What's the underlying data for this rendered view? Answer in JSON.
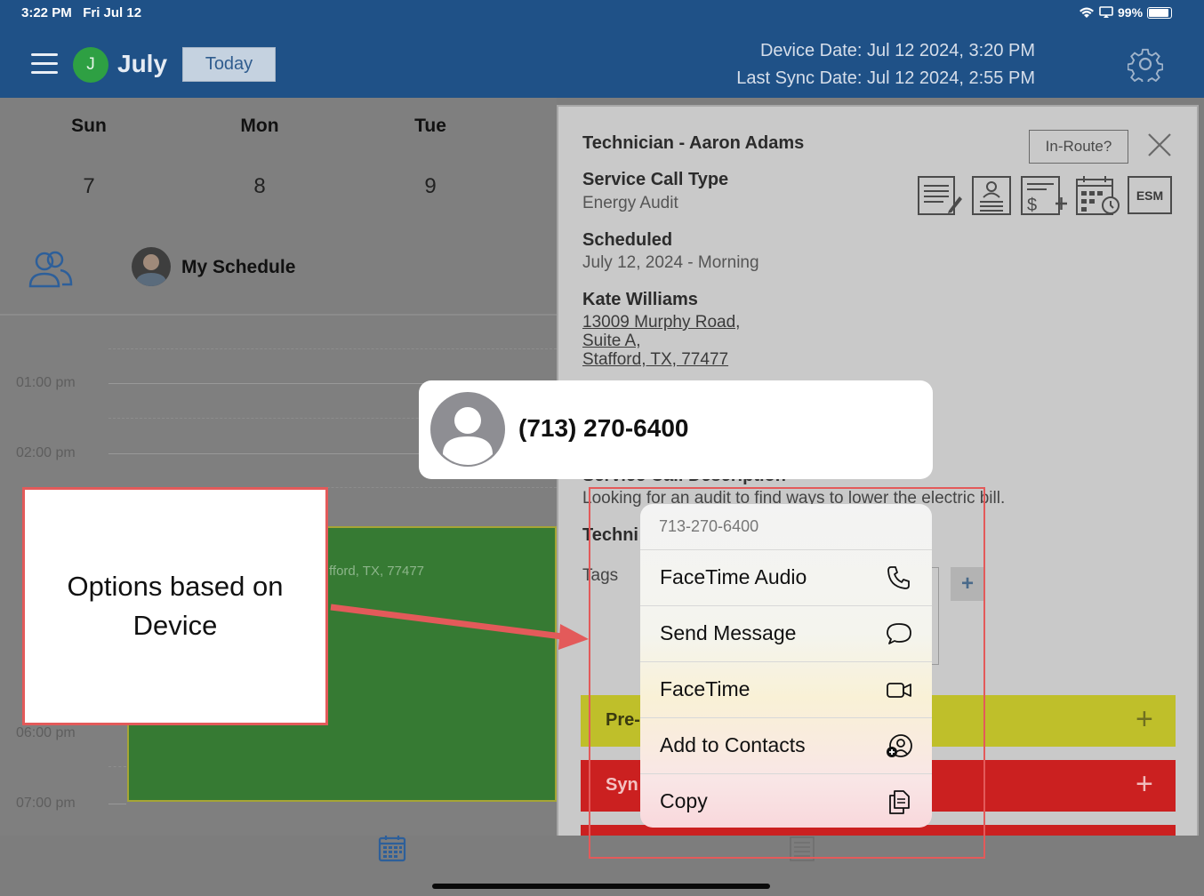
{
  "status_bar": {
    "time": "3:22 PM",
    "date": "Fri Jul 12",
    "battery": "99%"
  },
  "header": {
    "avatar_initial": "J",
    "month": "July",
    "today_label": "Today",
    "device_date": "Device Date: Jul 12 2024, 3:20 PM",
    "last_sync": "Last Sync Date: Jul 12 2024, 2:55 PM"
  },
  "calendar": {
    "days": [
      {
        "name": "Sun",
        "num": "7"
      },
      {
        "name": "Mon",
        "num": "8"
      },
      {
        "name": "Tue",
        "num": "9"
      }
    ],
    "my_schedule": "My Schedule",
    "times": [
      "01:00 pm",
      "02:00 pm",
      "06:00 pm",
      "07:00 pm"
    ],
    "event_address": "fford, TX, 77477"
  },
  "detail": {
    "technician": "Technician - Aaron Adams",
    "in_route": "In-Route?",
    "service_type_label": "Service Call Type",
    "service_type_value": "Energy Audit",
    "scheduled_label": "Scheduled",
    "scheduled_value": "July 12, 2024 - Morning",
    "customer_name": "Kate Williams",
    "address_line1": "13009 Murphy Road,",
    "address_line2": "Suite A,",
    "address_line3": "Stafford, TX, 77477",
    "description_label": "Service Call Description",
    "description_value": "Looking for an audit to find ways to lower the electric bill.",
    "tech_label": "Techni",
    "tags_label": "Tags",
    "esm_label": "ESM",
    "bar_pre": "Pre-",
    "bar_sync": "Syn",
    "plus": "+"
  },
  "phone_popup": {
    "number": "(713) 270-6400"
  },
  "context_menu": {
    "header": "713-270-6400",
    "items": [
      {
        "label": "FaceTime Audio",
        "icon": "phone-icon"
      },
      {
        "label": "Send Message",
        "icon": "message-bubble-icon"
      },
      {
        "label": "FaceTime",
        "icon": "video-camera-icon"
      },
      {
        "label": "Add to Contacts",
        "icon": "add-contact-icon"
      },
      {
        "label": "Copy",
        "icon": "copy-icon"
      }
    ]
  },
  "annotation": {
    "note": "Options based on Device"
  },
  "colors": {
    "header_bg": "#1f5187",
    "annotation_red": "#e35a5a",
    "event_green": "#367a33",
    "bar_yellow": "#bfbf2a",
    "bar_red": "#cb2020"
  }
}
